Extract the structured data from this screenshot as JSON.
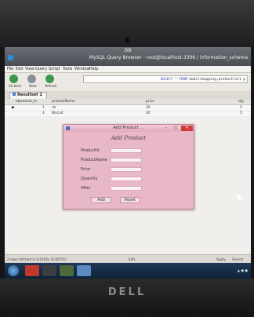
{
  "window": {
    "db_label": "DB",
    "title": "MySQL Query Browser - root@localhost:3306 / information_schema"
  },
  "menu": [
    "File",
    "Edit",
    "View",
    "Query",
    "Script",
    "Tools",
    "Window",
    "Help"
  ],
  "toolbar": {
    "buttons": [
      {
        "label": "Go back",
        "icon": "back-arrow-icon",
        "color": "#3a9a4a"
      },
      {
        "label": "Next",
        "icon": "forward-arrow-icon",
        "color": "#8a8e94"
      },
      {
        "label": "Refresh",
        "icon": "refresh-icon",
        "color": "#3a9a4a"
      }
    ],
    "query_keyword1": "SELECT",
    "query_mid": " * ",
    "query_keyword2": "FROM",
    "query_rest": " mobilshopping.productlist p"
  },
  "result_tab": {
    "label": "Resultset 1"
  },
  "grid": {
    "columns": [
      "idproduct_in",
      "productName",
      "price",
      "qty"
    ],
    "rows": [
      [
        "1",
        "nk",
        "30",
        "2"
      ],
      [
        "2",
        "Biscuit",
        "20",
        "5"
      ]
    ]
  },
  "dialog": {
    "title": "Add Product ...",
    "heading": "Add Product",
    "fields": [
      "ProductId",
      "ProductName",
      "Price",
      "Quantity",
      "Offer"
    ],
    "add_label": "Add",
    "reset_label": "Reset",
    "colors": {
      "background": "#e9b8c7",
      "close": "#d03c3c"
    }
  },
  "statusbar": {
    "text": "2 rows fetched in 0.0192s (0.0075s)",
    "edit_label": "Edit",
    "apply_label": "Apply",
    "search_label": "Search"
  },
  "laptop_brand": "DELL"
}
